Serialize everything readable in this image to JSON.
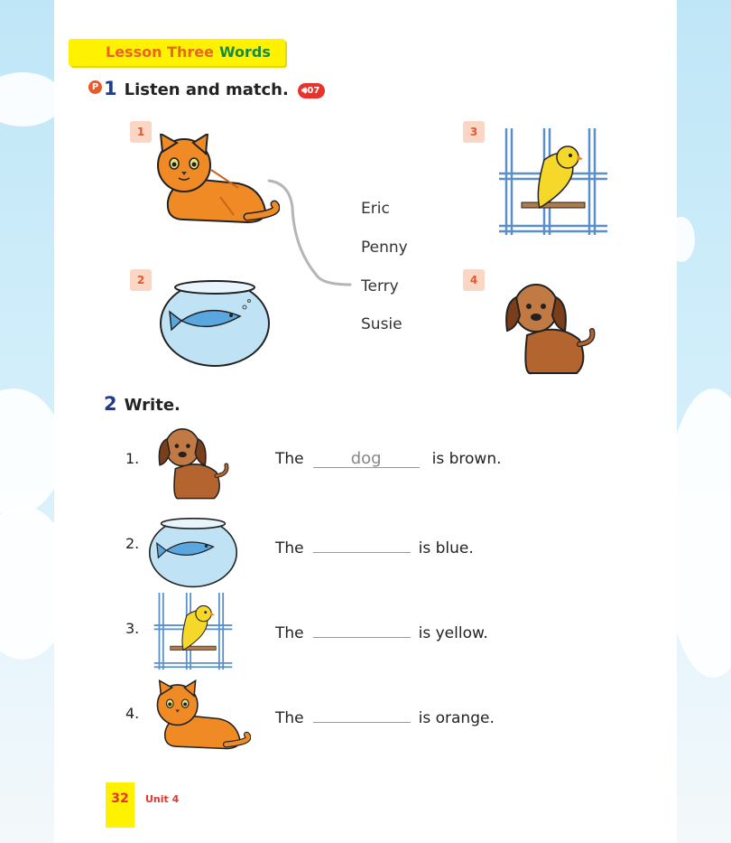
{
  "lesson_banner": {
    "part1": "Lesson Three",
    "part2": "Words"
  },
  "section1": {
    "badge": "P",
    "number": "1",
    "title": "Listen and match.",
    "audio_track": "07",
    "pictures": [
      {
        "number": "1",
        "animal": "cat"
      },
      {
        "number": "2",
        "animal": "fish"
      },
      {
        "number": "3",
        "animal": "bird"
      },
      {
        "number": "4",
        "animal": "dog"
      }
    ],
    "names": [
      "Eric",
      "Penny",
      "Terry",
      "Susie"
    ]
  },
  "section2": {
    "number": "2",
    "title": "Write.",
    "rows": [
      {
        "num": "1.",
        "before": "The",
        "answer": "dog",
        "after": "is brown.",
        "animal": "dog"
      },
      {
        "num": "2.",
        "before": "The",
        "answer": "",
        "after": "is blue.",
        "animal": "fish"
      },
      {
        "num": "3.",
        "before": "The",
        "answer": "",
        "after": "is yellow.",
        "animal": "bird"
      },
      {
        "num": "4.",
        "before": "The",
        "answer": "",
        "after": "is orange.",
        "animal": "cat"
      }
    ]
  },
  "footer": {
    "page_number": "32",
    "unit": "Unit 4"
  },
  "colors": {
    "banner": "#fff200",
    "section_number": "#1f3d8a",
    "number_box": "#fbd6c4",
    "number_text": "#e2582a",
    "audio": "#e8332a"
  }
}
